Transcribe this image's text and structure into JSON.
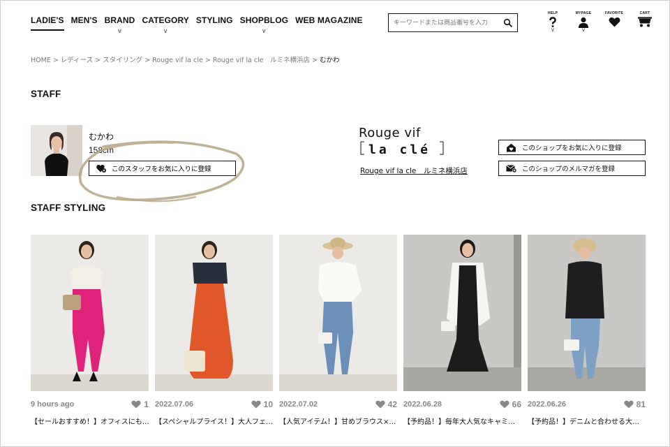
{
  "nav": {
    "items": [
      {
        "label": "LADIE'S",
        "active": true,
        "caret": ""
      },
      {
        "label": "MEN'S",
        "active": false,
        "caret": ""
      },
      {
        "label": "BRAND",
        "active": false,
        "caret": "v"
      },
      {
        "label": "CATEGORY",
        "active": false,
        "caret": "v"
      },
      {
        "label": "STYLING",
        "active": false,
        "caret": ""
      },
      {
        "label": "SHOPBLOG",
        "active": false,
        "caret": "v"
      },
      {
        "label": "WEB MAGAZINE",
        "active": false,
        "caret": ""
      }
    ]
  },
  "search": {
    "placeholder": "キーワードまたは商品番号を入力"
  },
  "utils": {
    "help": {
      "label": "HELP",
      "caret": "v"
    },
    "mypage": {
      "label": "MYPAGE",
      "caret": "v"
    },
    "favorite": {
      "label": "FAVORITE"
    },
    "cart": {
      "label": "CART"
    }
  },
  "breadcrumb": {
    "items": [
      "HOME",
      "レディース",
      "スタイリング",
      "Rouge vif la cle",
      "Rouge vif la cle　ルミネ横浜店"
    ],
    "current": "むかわ",
    "separator": ">"
  },
  "staff": {
    "heading": "STAFF",
    "name": "むかわ",
    "height": "158cm",
    "fav_button": "このスタッフをお気に入りに登録"
  },
  "shop": {
    "logo_line1": "Rouge vif",
    "logo_line2": "la clé",
    "name": "Rouge vif la cle　ルミネ横浜店",
    "fav_button": "このショップをお気に入りに登録",
    "mail_button": "このショップのメルマガを登録"
  },
  "styling": {
    "heading": "STAFF STYLING",
    "cards": [
      {
        "date": "9 hours ago",
        "likes": "1",
        "caption": "【セールおすすめ！】オフィスにも…"
      },
      {
        "date": "2022.07.06",
        "likes": "10",
        "caption": "【スペシャルプライス！】大人フェ…"
      },
      {
        "date": "2022.07.02",
        "likes": "42",
        "caption": "【人気アイテム！】甘めブラウス×…"
      },
      {
        "date": "2022.06.28",
        "likes": "66",
        "caption": "【予約品！】毎年大人気なキャミ…"
      },
      {
        "date": "2022.06.26",
        "likes": "81",
        "caption": "【予約品！】デニムと合わせる大…"
      }
    ]
  },
  "colors": {
    "text": "#111111",
    "muted": "#888888",
    "scribble": "#b9a98a"
  }
}
